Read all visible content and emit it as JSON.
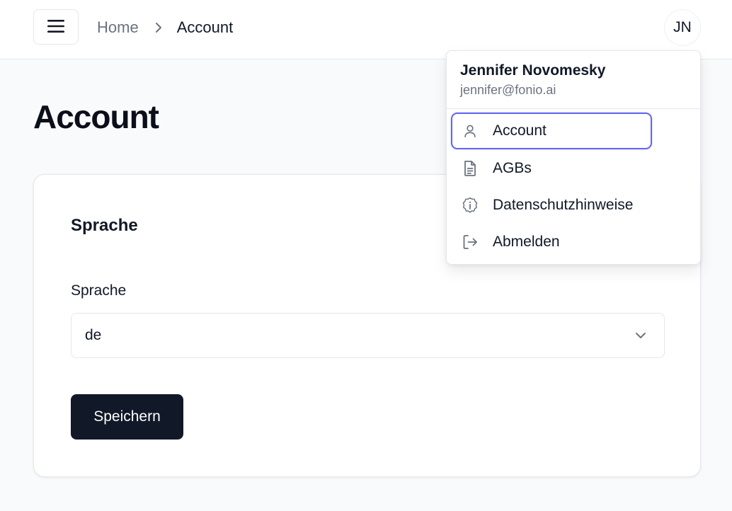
{
  "header": {
    "menu_icon": "hamburger-icon",
    "breadcrumb": {
      "home": "Home",
      "separator_icon": "chevron-right-icon",
      "current": "Account"
    },
    "avatar_initials": "JN"
  },
  "page": {
    "title": "Account"
  },
  "language_card": {
    "section_title": "Sprache",
    "field_label": "Sprache",
    "selected_value": "de",
    "chevron_icon": "chevron-down-icon",
    "save_label": "Speichern"
  },
  "user_menu": {
    "name": "Jennifer Novomesky",
    "email": "jennifer@fonio.ai",
    "items": [
      {
        "label": "Account",
        "icon": "user-icon",
        "active": true
      },
      {
        "label": "AGBs",
        "icon": "document-icon",
        "active": false
      },
      {
        "label": "Datenschutzhinweise",
        "icon": "info-badge-icon",
        "active": false
      },
      {
        "label": "Abmelden",
        "icon": "logout-icon",
        "active": false
      }
    ]
  },
  "colors": {
    "primary_button": "#111827",
    "focus_ring": "#6366f1",
    "muted_text": "#6b7280",
    "page_background": "#f9fafb"
  }
}
